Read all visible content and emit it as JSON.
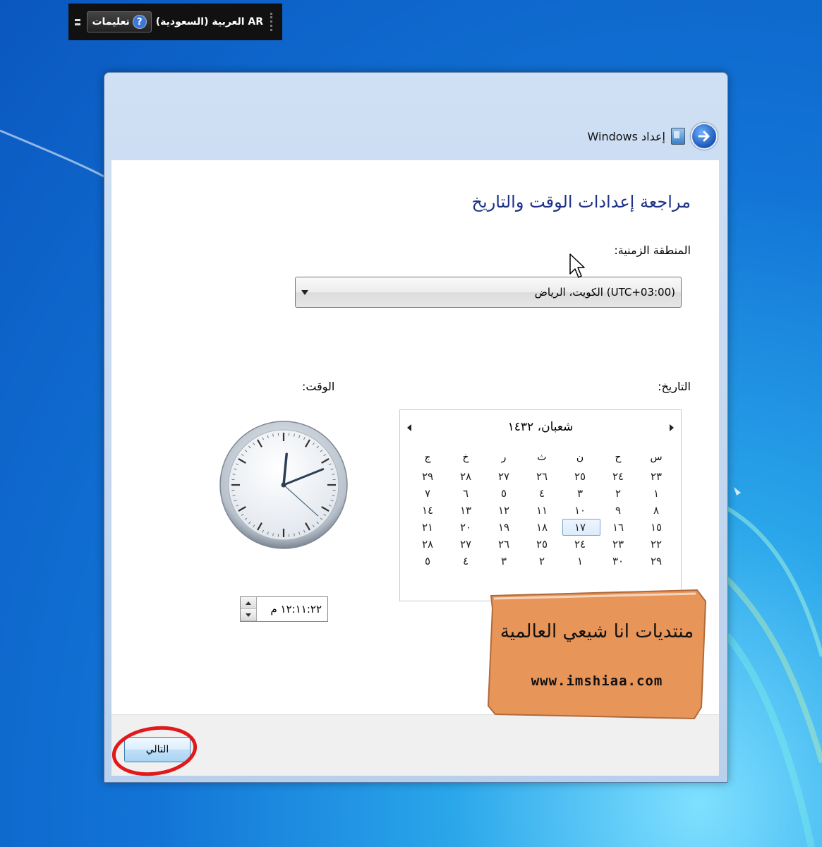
{
  "language_bar": {
    "language": "AR العربية (السعودية)",
    "help_label": "تعليمات",
    "help_icon": "help-question-icon",
    "minimize_icon": "minimize-icon"
  },
  "window": {
    "title": "إعداد Windows",
    "back_icon": "back-arrow-icon",
    "setup_icon": "windows-setup-icon"
  },
  "page": {
    "heading": "مراجعة إعدادات الوقت والتاريخ",
    "timezone_label": "المنطقة الزمنية:",
    "timezone_value": "(UTC+03:00) الكويت، الرياض",
    "date_label": "التاريخ:",
    "time_label": "الوقت:"
  },
  "calendar": {
    "month_title": "شعبان، ١٤٣٢",
    "weekdays": [
      "س",
      "ح",
      "ن",
      "ث",
      "ر",
      "خ",
      "ج"
    ],
    "weeks": [
      [
        "٢٣",
        "٢٤",
        "٢٥",
        "٢٦",
        "٢٧",
        "٢٨",
        "٢٩"
      ],
      [
        "١",
        "٢",
        "٣",
        "٤",
        "٥",
        "٦",
        "٧"
      ],
      [
        "٨",
        "٩",
        "١٠",
        "١١",
        "١٢",
        "١٣",
        "١٤"
      ],
      [
        "١٥",
        "١٦",
        "١٧",
        "١٨",
        "١٩",
        "٢٠",
        "٢١"
      ],
      [
        "٢٢",
        "٢٣",
        "٢٤",
        "٢٥",
        "٢٦",
        "٢٧",
        "٢٨"
      ],
      [
        "٢٩",
        "٣٠",
        "١",
        "٢",
        "٣",
        "٤",
        "٥"
      ]
    ],
    "selected": "١٧"
  },
  "clock": {
    "hour": 12,
    "minute": 11,
    "second": 22
  },
  "time_field": {
    "value": "١٢:١١:٢٢ م"
  },
  "footer": {
    "next_label": "التالي"
  },
  "watermark": {
    "arabic": "منتديات انا شيعي العالمية",
    "url": "www.imshiaa.com"
  },
  "colors": {
    "heading": "#1e3287",
    "desktop": "#1274d6",
    "watermark_bg": "#e8955a",
    "annotation_ring": "#e01a1a"
  }
}
